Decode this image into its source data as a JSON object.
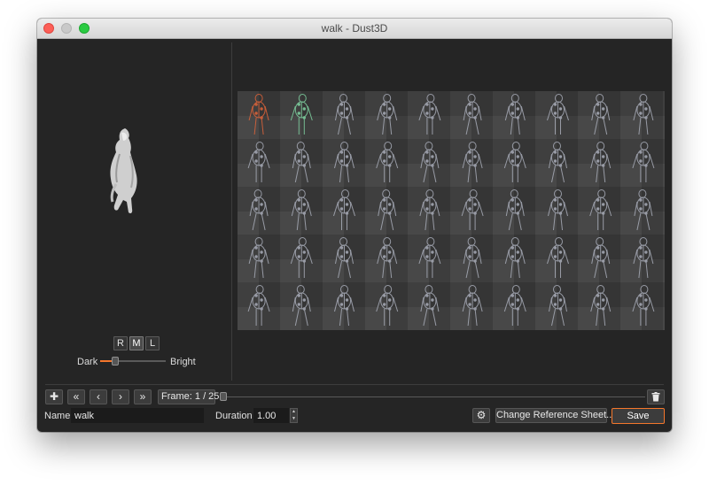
{
  "window": {
    "title": "walk - Dust3D"
  },
  "preview": {
    "light_buttons": [
      "R",
      "M",
      "L"
    ],
    "active_light_button": "M",
    "dark_label": "Dark",
    "bright_label": "Bright",
    "brightness_level": 0.2
  },
  "sheet": {
    "columns": 10,
    "rows": 5,
    "current_frame": 1,
    "next_frame": 2,
    "current_color": "#e0643a",
    "next_color": "#7fd3a1",
    "frame_color": "#a8acb8"
  },
  "toolbar": {
    "add_icon": "plus-icon",
    "first_icon": "double-chevron-left-icon",
    "prev_icon": "chevron-left-icon",
    "next_icon": "chevron-right-icon",
    "last_icon": "double-chevron-right-icon",
    "frame_text": "Frame:  1 / 25",
    "timeline_position": 0,
    "delete_icon": "trash-icon"
  },
  "form": {
    "name_label": "Name",
    "name_value": "walk",
    "duration_label": "Duration",
    "duration_value": "1.00",
    "settings_icon": "gear-icon",
    "change_sheet_label": "Change Reference Sheet...",
    "save_label": "Save"
  },
  "colors": {
    "accent": "#f5772c",
    "background": "#252525"
  }
}
